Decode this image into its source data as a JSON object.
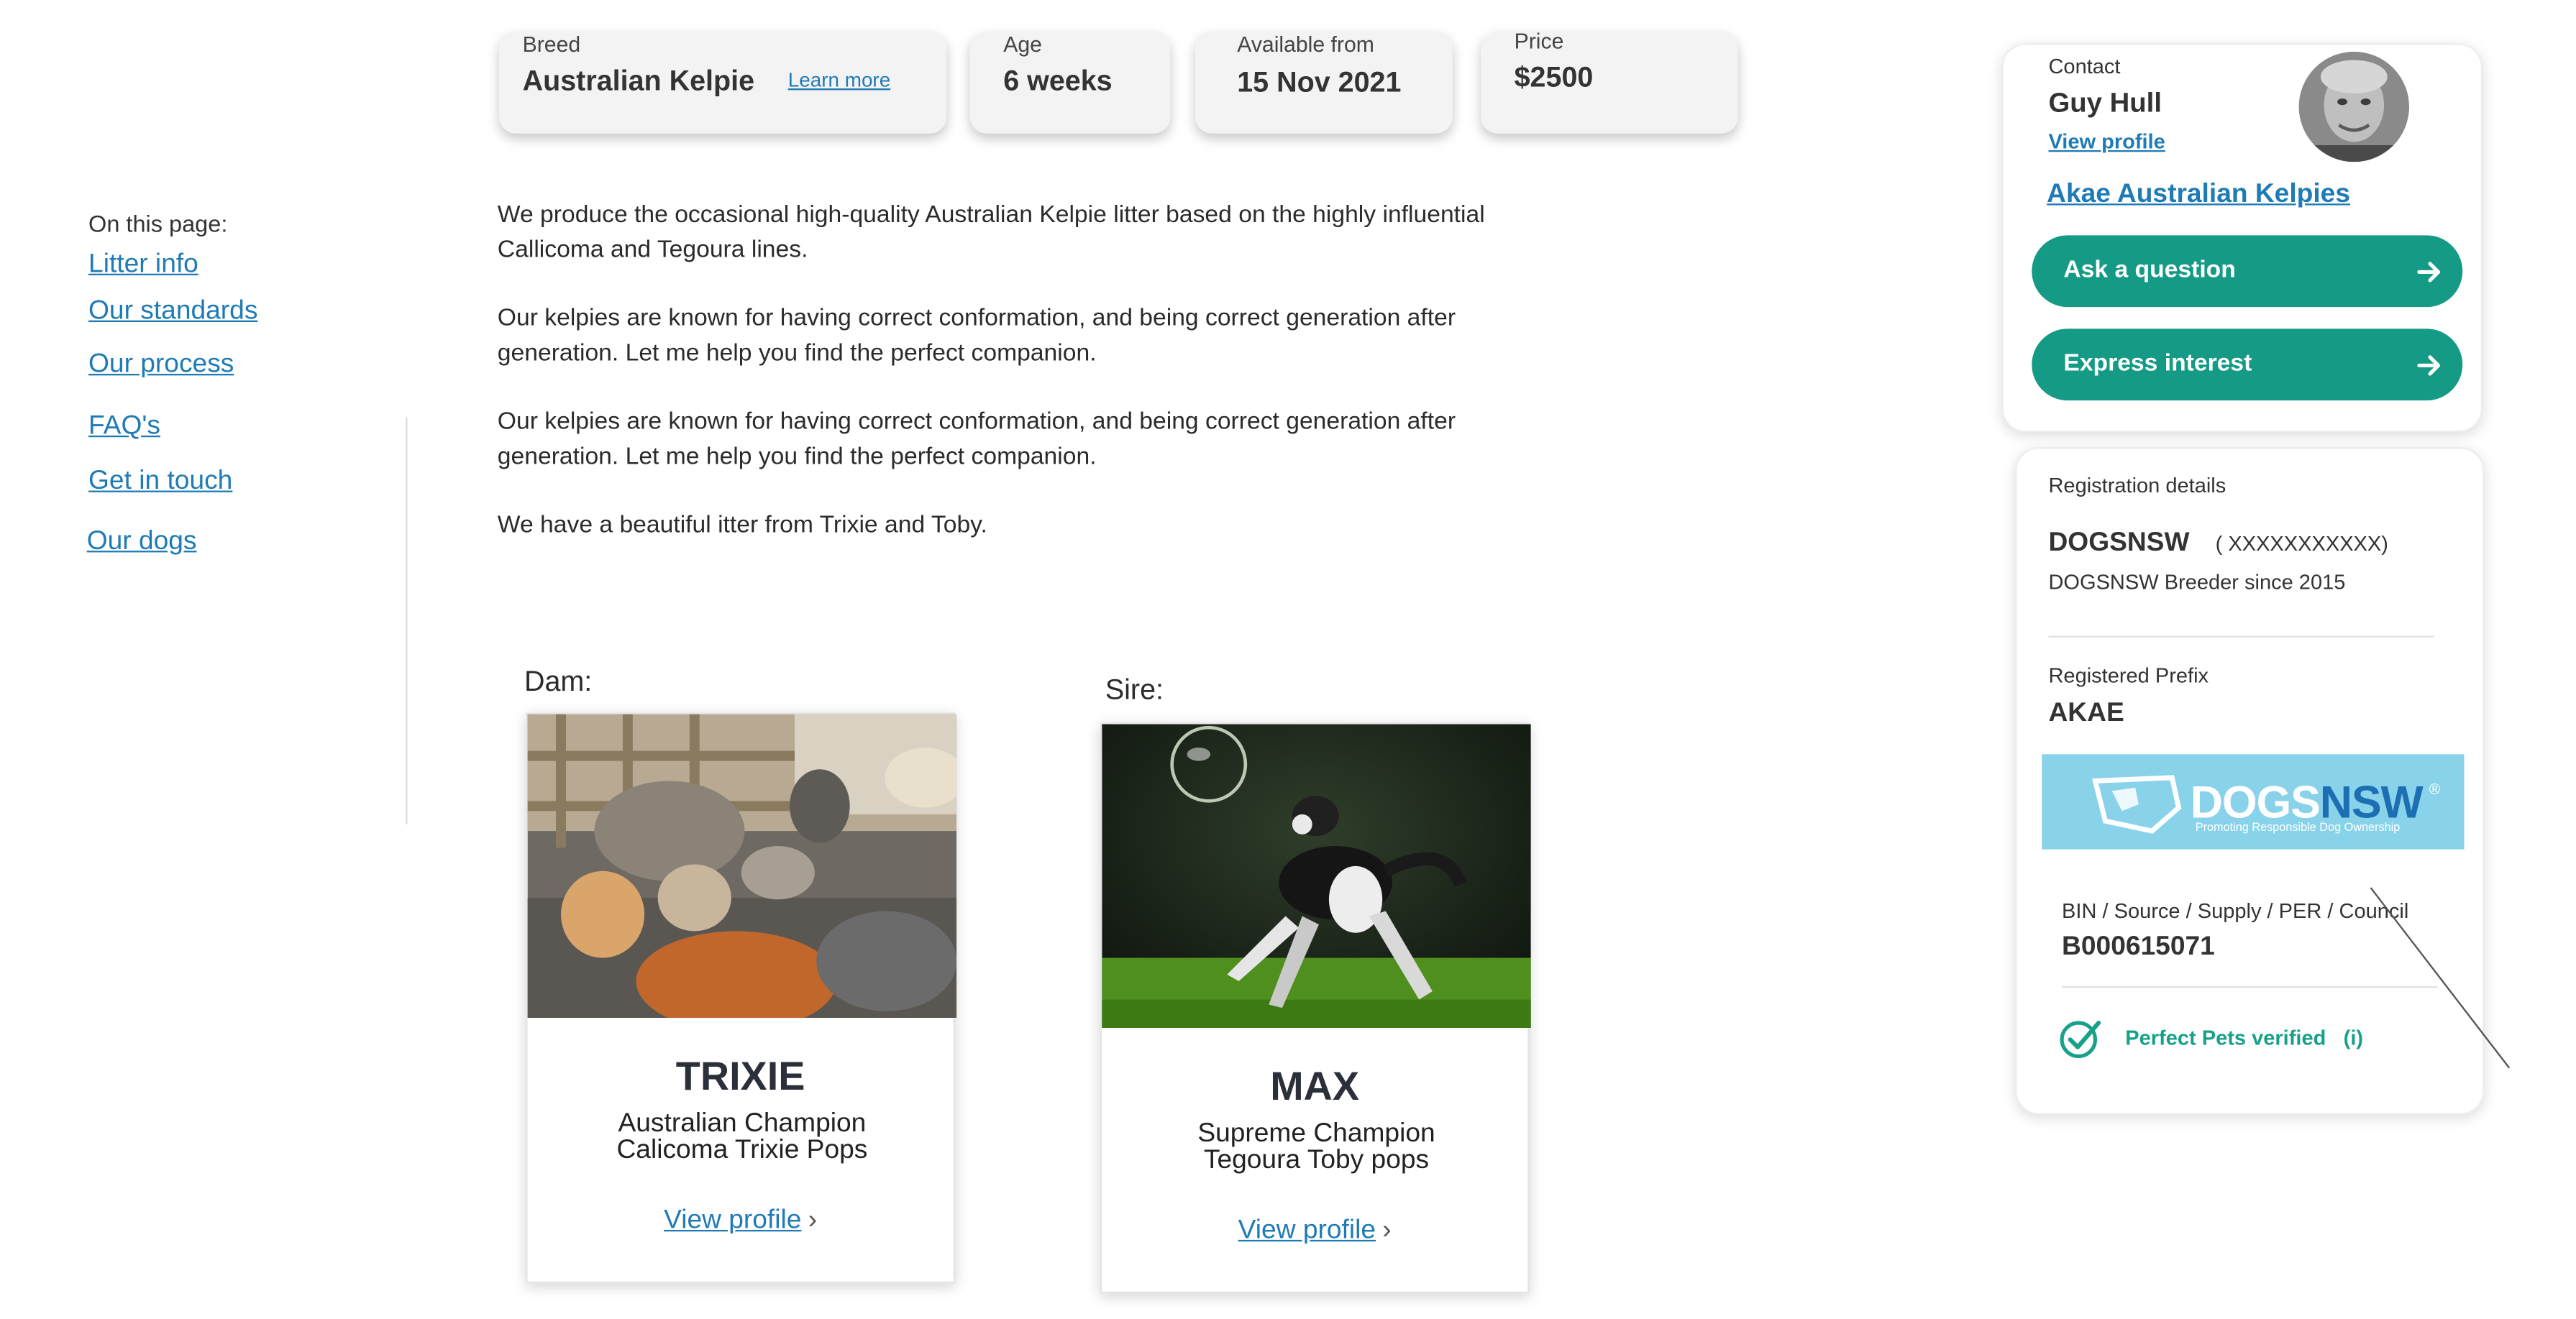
{
  "summary": {
    "breed_label": "Breed",
    "breed_value": "Australian Kelpie",
    "learn_more": "Learn more",
    "age_label": "Age",
    "age_value": "6 weeks",
    "available_label": "Available from",
    "available_value": "15 Nov 2021",
    "price_label": "Price",
    "price_value": "$2500"
  },
  "nav": {
    "title": "On this page:",
    "items": [
      "Litter info",
      "Our standards",
      "Our process",
      "FAQ's",
      "Get in touch",
      "Our dogs"
    ]
  },
  "content": {
    "paragraphs": [
      "We produce the occasional high-quality Australian Kelpie litter based on the highly influential Callicoma and Tegoura lines.",
      "Our kelpies are known for having correct conformation, and being correct generation after generation. Let me help you find the perfect companion.",
      "Our kelpies are known for having correct conformation, and being correct generation after generation. Let me help you find the perfect companion.",
      "We have a beautiful itter from Trixie and Toby."
    ]
  },
  "dam": {
    "role": "Dam:",
    "name": "TRIXIE",
    "title_line1": "Australian Champion",
    "title_line2": "Calicoma Trixie Pops",
    "link": "View profile",
    "chevron": "›"
  },
  "sire": {
    "role": "Sire:",
    "name": "MAX",
    "title_line1": "Supreme Champion",
    "title_line2": "Tegoura Toby pops",
    "link": "View profile",
    "chevron": "›"
  },
  "contact": {
    "label": "Contact",
    "name": "Guy Hull",
    "view_profile": "View profile",
    "kennel": "Akae Australian Kelpies",
    "ask_button": "Ask a question",
    "interest_button": "Express interest",
    "accent": "#159a86"
  },
  "registration": {
    "title": "Registration details",
    "body_name": "DOGSNSW",
    "number": "( XXXXXXXXXXX)",
    "since": "DOGSNSW Breeder since 2015",
    "prefix_label": "Registered Prefix",
    "prefix_value": "AKAE",
    "logo_text_a": "DOGS",
    "logo_text_b": "NSW",
    "logo_registered": "®",
    "logo_tagline": "Promoting Responsible Dog Ownership",
    "bin_label": "BIN / Source / Supply / PER / Council",
    "bin_value": "B000615071",
    "verified_text": "Perfect Pets verified",
    "info_marker": "(i)"
  }
}
